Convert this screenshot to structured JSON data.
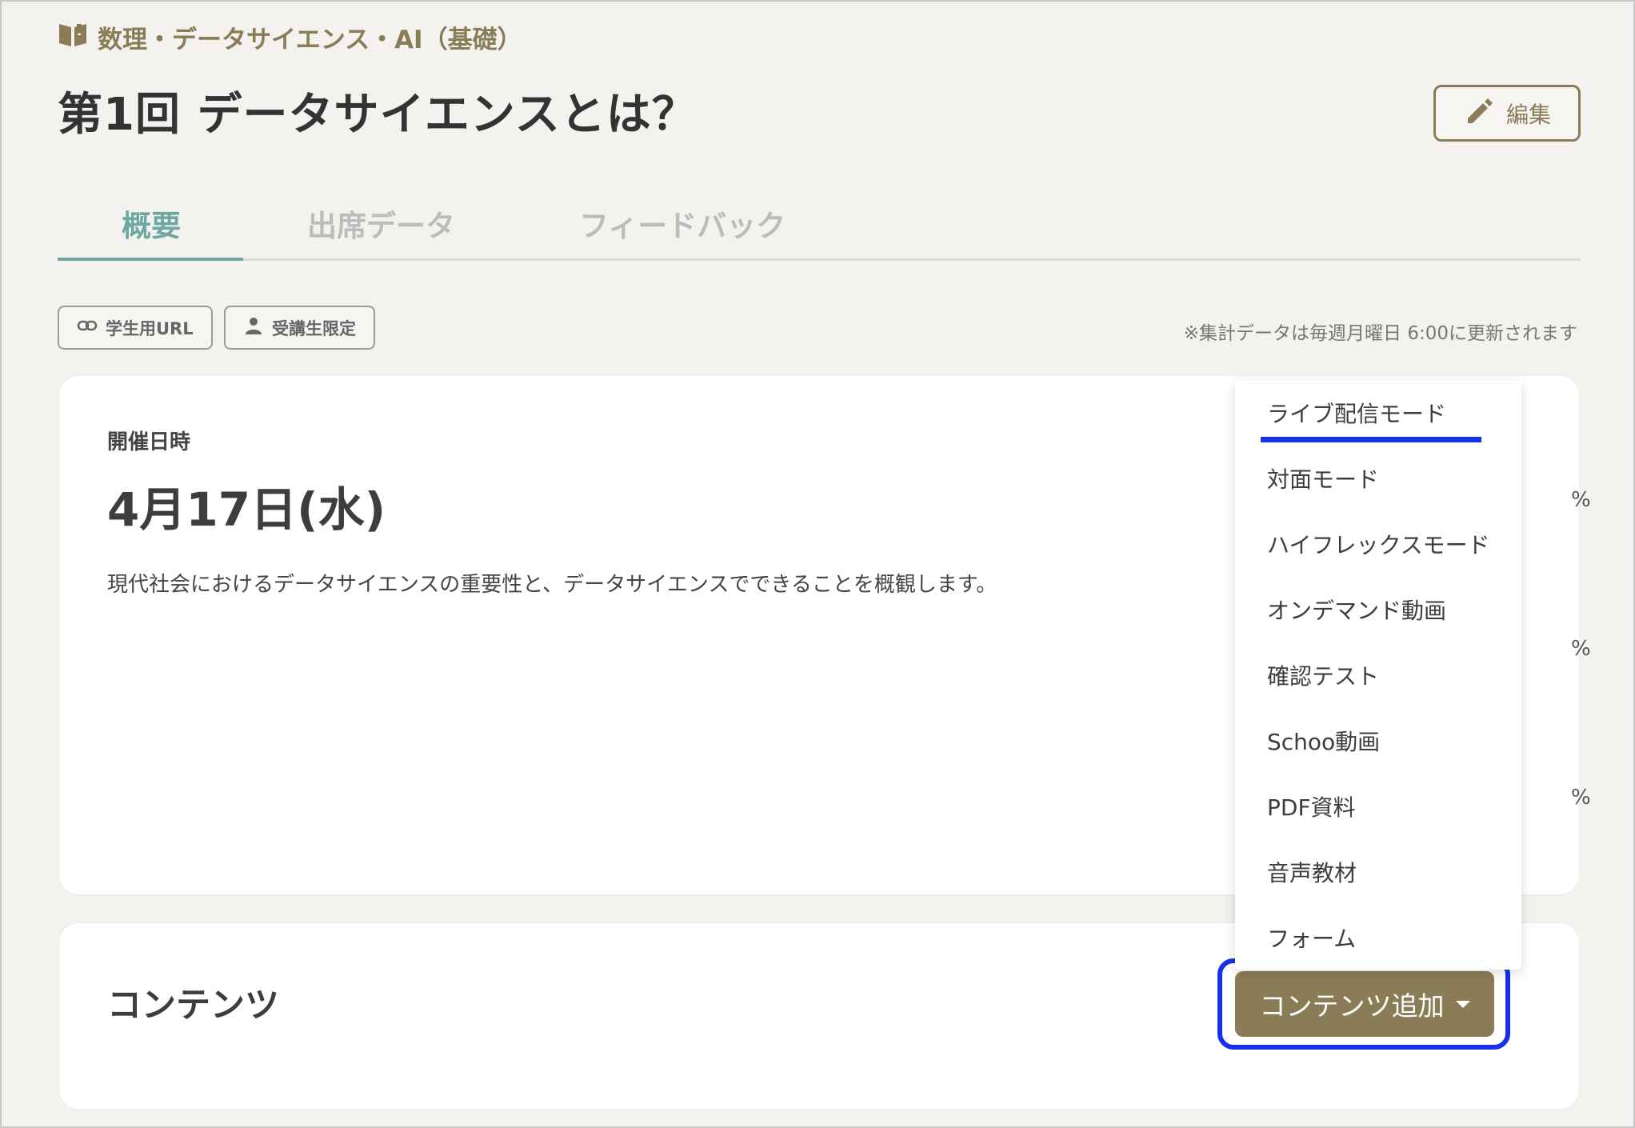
{
  "breadcrumb": {
    "label": "数理・データサイエンス・AI（基礎）",
    "icon": "book-icon"
  },
  "page": {
    "title": "第1回 データサイエンスとは？"
  },
  "header": {
    "edit_label": "編集"
  },
  "tabs": [
    {
      "label": "概要",
      "active": true
    },
    {
      "label": "出席データ",
      "active": false
    },
    {
      "label": "フィードバック",
      "active": false
    }
  ],
  "chips": [
    {
      "label": "学生用URL",
      "icon": "link-icon"
    },
    {
      "label": "受講生限定",
      "icon": "person-icon"
    }
  ],
  "update_note": "※集計データは毎週月曜日 6:00に更新されます",
  "schedule": {
    "label": "開催日時",
    "date": "4月17日(水)",
    "description": "現代社会におけるデータサイエンスの重要性と、データサイエンスでできることを概観します。"
  },
  "peek_values": [
    "%",
    "%",
    "%"
  ],
  "contents": {
    "title": "コンテンツ",
    "add_button_label": "コンテンツ追加"
  },
  "dropdown": {
    "items": [
      "ライブ配信モード",
      "対面モード",
      "ハイフレックスモード",
      "オンデマンド動画",
      "確認テスト",
      "Schoo動画",
      "PDF資料",
      "音声教材",
      "フォーム"
    ],
    "highlighted_index": 0
  },
  "colors": {
    "accent": "#8a7c57",
    "tab_active": "#6fa8a3",
    "highlight": "#1530e6",
    "background": "#f3f2ee"
  }
}
